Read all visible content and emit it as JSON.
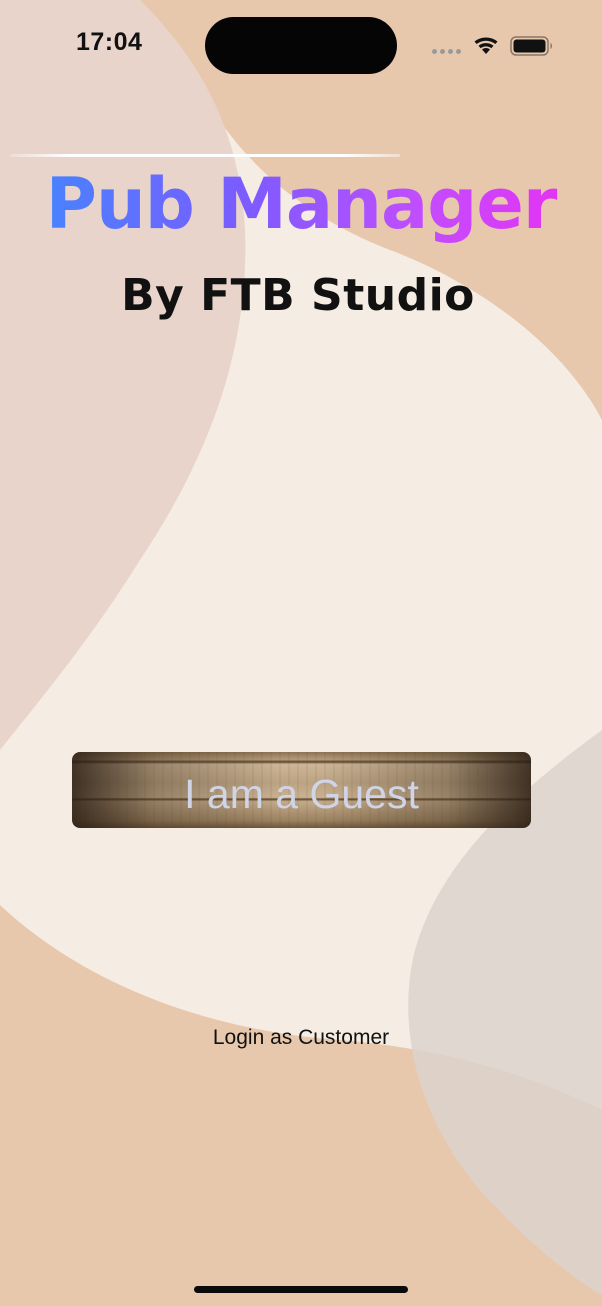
{
  "status_bar": {
    "time": "17:04",
    "icons": [
      "signal-icon",
      "wifi-icon",
      "battery-icon"
    ]
  },
  "logo": {
    "title": "Pub Manager",
    "subtitle": "By FTB Studio",
    "gradient_colors": [
      "#3d8bff",
      "#7a5cff",
      "#c24dff",
      "#ee2bf0"
    ]
  },
  "actions": {
    "guest_label": "I am a Guest",
    "customer_login_label": "Login as Customer"
  },
  "colors": {
    "background": "#f5ece4",
    "blob_peach": "#e8c8ad",
    "blob_rose": "#e9d4cb",
    "blob_gray": "#e2ddd9",
    "guest_text": "#cfd4e6"
  }
}
